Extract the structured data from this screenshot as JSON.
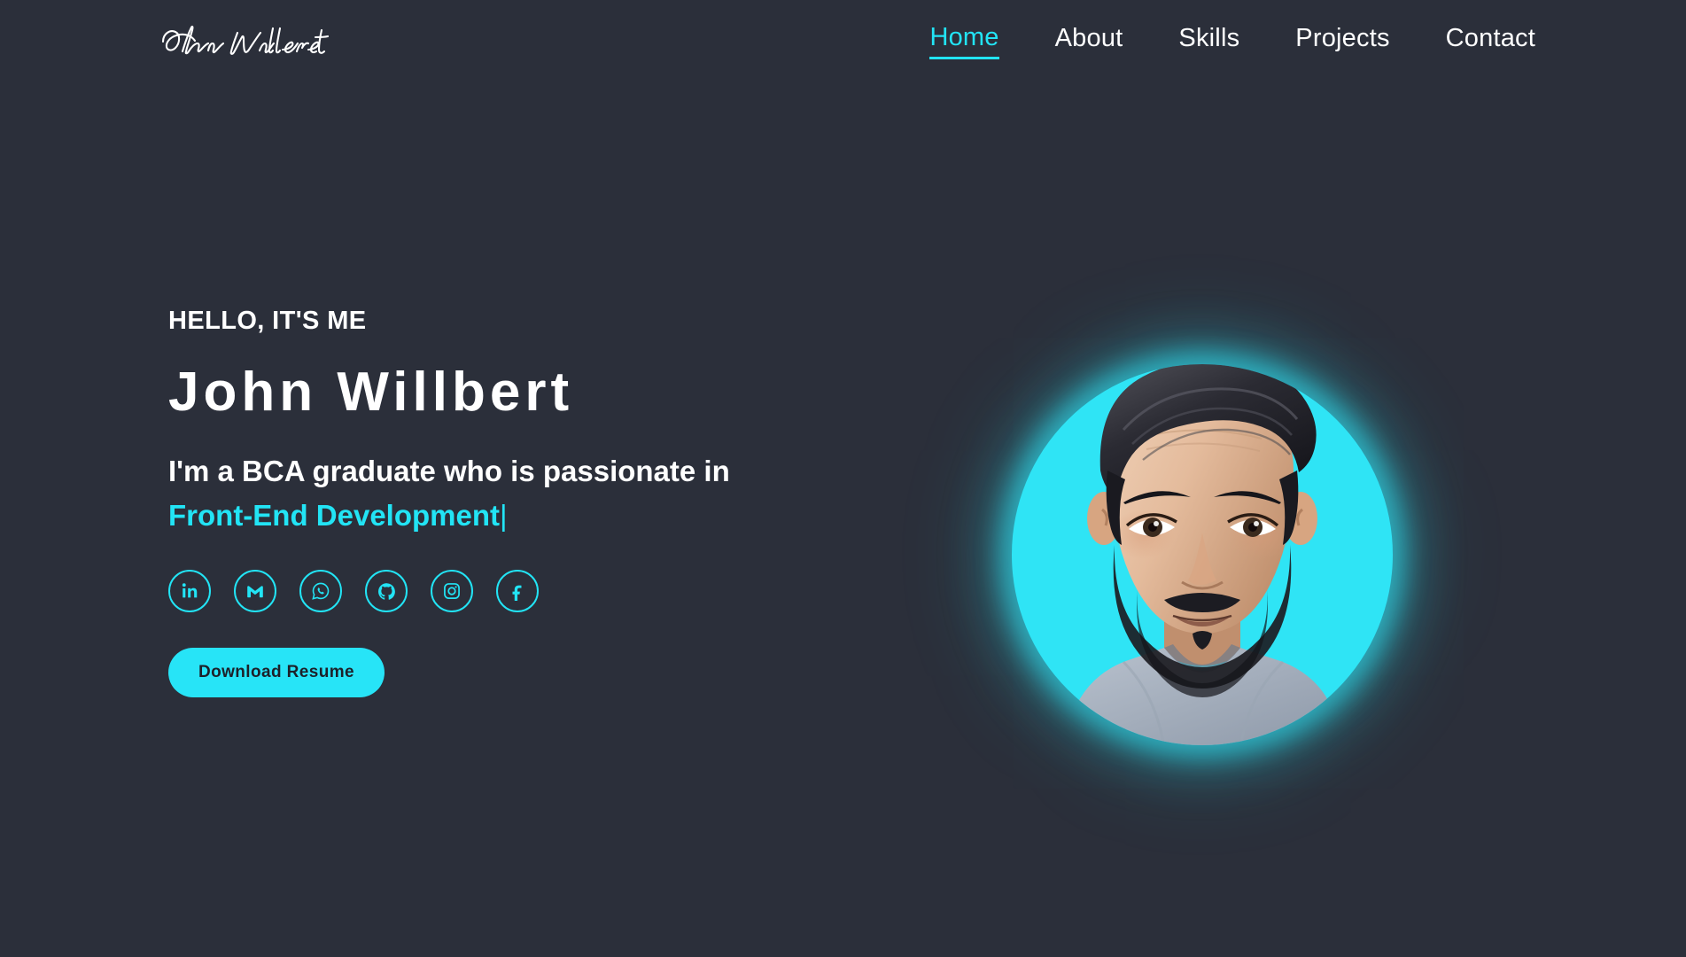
{
  "theme": {
    "background": "#2b2f3a",
    "accent": "#22e4f5",
    "accent_solid": "#2fe4f5",
    "text": "#ffffff",
    "button_text": "#1d2029"
  },
  "header": {
    "logo_name": "John Willbert",
    "logo_icon": "signature-logo",
    "nav": [
      {
        "label": "Home",
        "active": true
      },
      {
        "label": "About",
        "active": false
      },
      {
        "label": "Skills",
        "active": false
      },
      {
        "label": "Projects",
        "active": false
      },
      {
        "label": "Contact",
        "active": false
      }
    ]
  },
  "hero": {
    "greeting": "HELLO, IT'S ME",
    "name": "John Willbert",
    "subtitle_prefix": "I'm a BCA graduate who is passionate in ",
    "subtitle_accent": "Front-End Development",
    "typing_caret": "|",
    "resume_button": "Download Resume",
    "portrait_alt": "John Willbert portrait",
    "socials": [
      {
        "name": "linkedin",
        "icon": "linkedin-icon",
        "label": "LinkedIn"
      },
      {
        "name": "gmail",
        "icon": "gmail-icon",
        "label": "Gmail"
      },
      {
        "name": "whatsapp",
        "icon": "whatsapp-icon",
        "label": "WhatsApp"
      },
      {
        "name": "github",
        "icon": "github-icon",
        "label": "GitHub"
      },
      {
        "name": "instagram",
        "icon": "instagram-icon",
        "label": "Instagram"
      },
      {
        "name": "facebook",
        "icon": "facebook-icon",
        "label": "Facebook"
      }
    ]
  }
}
